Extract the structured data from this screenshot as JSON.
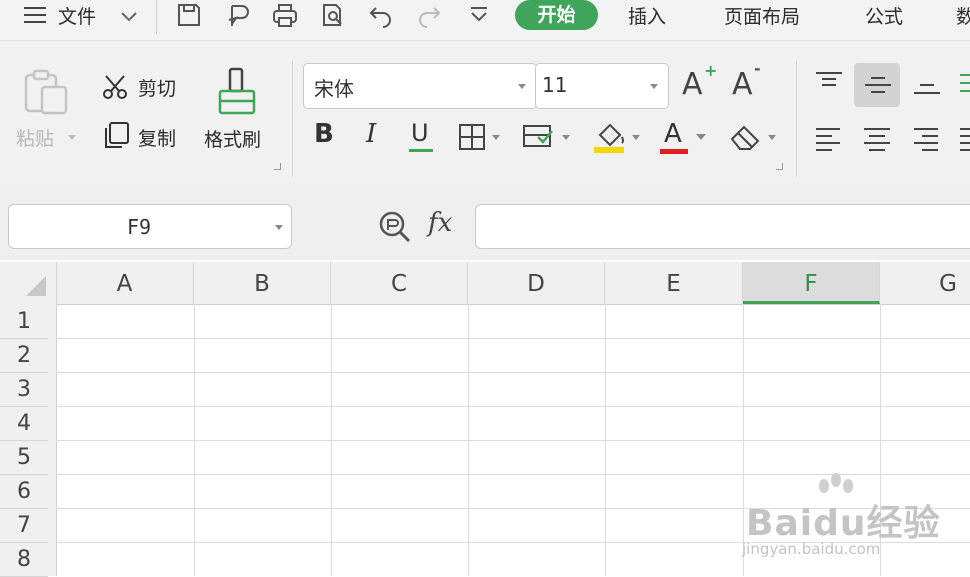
{
  "menubar": {
    "menu_icon": "hamburger-icon",
    "file_label": "文件",
    "tabs": [
      "开始",
      "插入",
      "页面布局",
      "公式",
      "数"
    ],
    "active_tab": "开始",
    "quick_icons": [
      "save-icon",
      "export-icon",
      "print-icon",
      "print-preview-icon",
      "undo-icon",
      "redo-icon",
      "customize-dropdown-icon"
    ]
  },
  "ribbon": {
    "clipboard": {
      "paste_label": "粘贴",
      "cut_label": "剪切",
      "copy_label": "复制",
      "format_painter_label": "格式刷"
    },
    "font": {
      "font_name": "宋体",
      "font_size": "11",
      "bold": "B",
      "italic": "I",
      "underline": "U",
      "increase_size": "A",
      "decrease_size": "A",
      "font_color_letter": "A",
      "highlight_color": "#f2d700",
      "font_color": "#e02020"
    }
  },
  "formula_bar": {
    "name_box": "F9",
    "fx_label": "fx",
    "formula_value": ""
  },
  "sheet": {
    "columns": [
      "A",
      "B",
      "C",
      "D",
      "E",
      "F",
      "G"
    ],
    "selected_column": "F",
    "rows": [
      "1",
      "2",
      "3",
      "4",
      "5",
      "6",
      "7",
      "8"
    ]
  },
  "watermark": {
    "logo": "Baidu经验",
    "site": "jingyan.baidu.com"
  },
  "colors": {
    "accent": "#3fa55a"
  }
}
